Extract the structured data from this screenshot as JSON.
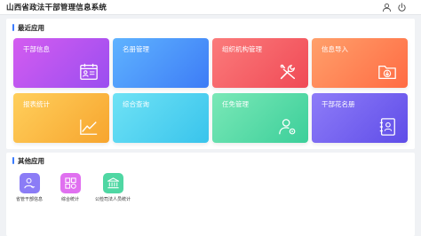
{
  "header": {
    "title": "山西省政法干部管理信息系统",
    "icons": [
      "user-icon",
      "power-icon"
    ]
  },
  "recent": {
    "title": "最近应用",
    "tiles": [
      {
        "label": "干部信息",
        "icon": "calendar-person-icon",
        "color": "#b855f0"
      },
      {
        "label": "名册管理",
        "icon": "none",
        "color": "#4a90f8"
      },
      {
        "label": "组织机构管理",
        "icon": "tools-icon",
        "color": "#f55a62"
      },
      {
        "label": "信息导入",
        "icon": "folder-download-icon",
        "color": "#ff7d52"
      },
      {
        "label": "报表统计",
        "icon": "line-chart-icon",
        "color": "#fbb842"
      },
      {
        "label": "综合查询",
        "icon": "none",
        "color": "#4fd0ef"
      },
      {
        "label": "任免管理",
        "icon": "person-gear-icon",
        "color": "#52d9a6"
      },
      {
        "label": "干部花名册",
        "icon": "contact-book-icon",
        "color": "#6f5bf0"
      }
    ]
  },
  "other": {
    "title": "其他应用",
    "items": [
      {
        "label": "省管干部信息",
        "icon": "person-doc-icon",
        "color": "#8b7cf6"
      },
      {
        "label": "综合统计",
        "icon": "grid-stats-icon",
        "color": "#e070f0"
      },
      {
        "label": "公检司法人员统计",
        "icon": "courthouse-icon",
        "color": "#4fd7a3"
      }
    ]
  }
}
